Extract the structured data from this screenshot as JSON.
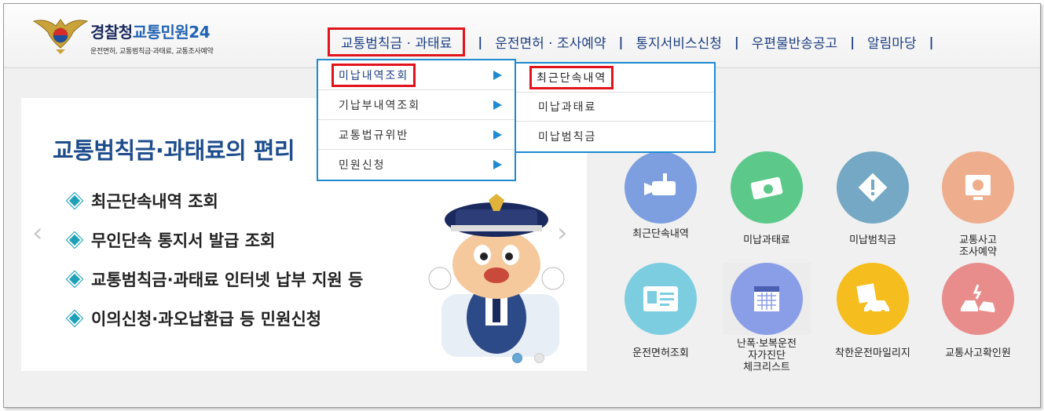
{
  "logo": {
    "title_part1": "경찰청",
    "title_part2": "교통민원24",
    "subtitle": "운전면허, 교통범칙금·과태료, 교통조사예약",
    "emblem_icon": "police-emblem-icon"
  },
  "gnb": {
    "items": [
      {
        "label": "교통범칙금 · 과태료",
        "active": true
      },
      {
        "label": "운전면허 · 조사예약"
      },
      {
        "label": "통지서비스신청"
      },
      {
        "label": "우편물반송공고"
      },
      {
        "label": "알림마당"
      }
    ],
    "separator": "|"
  },
  "dropdown": {
    "level1": [
      {
        "label": "미납내역조회",
        "selected": true
      },
      {
        "label": "기납부내역조회"
      },
      {
        "label": "교통법규위반"
      },
      {
        "label": "민원신청"
      }
    ],
    "level2": [
      {
        "label": "최근단속내역",
        "selected": true
      },
      {
        "label": "미납과태료"
      },
      {
        "label": "미납범칙금"
      }
    ]
  },
  "hero": {
    "title": "교통범칙금·과태료의 편리",
    "list": [
      "최근단속내역 조회",
      "무인단속 통지서 발급 조회",
      "교통범칙금·과태료 인터넷 납부 지원 등",
      "이의신청·과오납환급 등 민원신청"
    ],
    "prev_arrow": "‹",
    "next_arrow": "›"
  },
  "quick": [
    {
      "label": "최근단속내역",
      "icon": "camera-icon",
      "color": "#7d9fe0"
    },
    {
      "label": "미납과태료",
      "icon": "money-icon",
      "color": "#5cc98a"
    },
    {
      "label": "미납범칙금",
      "icon": "warning-sign-icon",
      "color": "#74a8c4"
    },
    {
      "label": "교통사고\n조사예약",
      "icon": "monitor-icon",
      "color": "#eeae8e"
    },
    {
      "label": "운전면허조회",
      "icon": "license-card-icon",
      "color": "#7dcde0"
    },
    {
      "label": "난폭·보복운전\n자가진단\n체크리스트",
      "icon": "calendar-icon",
      "color": "#8a9ee8"
    },
    {
      "label": "착한운전마일리지",
      "icon": "mileage-car-icon",
      "color": "#f6bd1e"
    },
    {
      "label": "교통사고확인원",
      "icon": "car-crash-icon",
      "color": "#e88c8c"
    }
  ]
}
